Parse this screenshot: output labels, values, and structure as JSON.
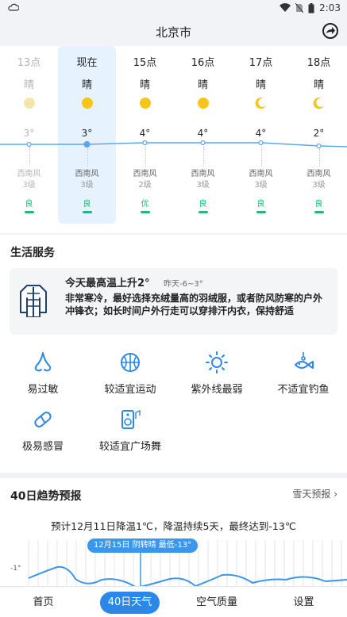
{
  "status": {
    "time": "2:03"
  },
  "header": {
    "city": "北京市",
    "share_icon": "share-icon"
  },
  "hourly": [
    {
      "label": "13点",
      "cond": "晴",
      "icon": "sun",
      "temp": "3°",
      "wind": "西南风",
      "level": "3级",
      "aqi": "良",
      "aqi_color": "#27b57c",
      "state": "past",
      "temp_value": 3
    },
    {
      "label": "现在",
      "cond": "晴",
      "icon": "sun",
      "temp": "3°",
      "wind": "西南风",
      "level": "3级",
      "aqi": "良",
      "aqi_color": "#27b57c",
      "state": "current",
      "temp_value": 3
    },
    {
      "label": "15点",
      "cond": "晴",
      "icon": "sun",
      "temp": "4°",
      "wind": "西南风",
      "level": "2级",
      "aqi": "优",
      "aqi_color": "#27b57c",
      "state": "future",
      "temp_value": 4
    },
    {
      "label": "16点",
      "cond": "晴",
      "icon": "sun",
      "temp": "4°",
      "wind": "西南风",
      "level": "3级",
      "aqi": "良",
      "aqi_color": "#27b57c",
      "state": "future",
      "temp_value": 4
    },
    {
      "label": "17点",
      "cond": "晴",
      "icon": "moon",
      "temp": "4°",
      "wind": "西南风",
      "level": "3级",
      "aqi": "良",
      "aqi_color": "#27b57c",
      "state": "future",
      "temp_value": 4
    },
    {
      "label": "18点",
      "cond": "晴",
      "icon": "moon",
      "temp": "2°",
      "wind": "西南风",
      "level": "3级",
      "aqi": "良",
      "aqi_color": "#27b57c",
      "state": "future",
      "temp_value": 2
    }
  ],
  "life": {
    "title": "生活服务",
    "tip": {
      "headline": "今天最高温上升2°",
      "sub": "昨天-6~3°",
      "body": "非常寒冷，最好选择充绒量高的羽绒服，或者防风防寒的户外冲锋衣；如长时间户外行走可以穿排汗内衣，保持舒适"
    },
    "services": [
      {
        "label": "易过敏",
        "icon": "nose-icon"
      },
      {
        "label": "较适宜运动",
        "icon": "basketball-icon"
      },
      {
        "label": "紫外线最弱",
        "icon": "sun-icon"
      },
      {
        "label": "不适宜钓鱼",
        "icon": "fish-icon"
      },
      {
        "label": "极易感冒",
        "icon": "pill-icon"
      },
      {
        "label": "较适宜广场舞",
        "icon": "speaker-icon"
      }
    ]
  },
  "trend": {
    "title": "40日趋势预报",
    "link": "雪天预报",
    "summary": "预计12月11日降温1℃，降温持续5天，最终达到-13℃",
    "bubble": "12月15日 阴转晴 最低-13°",
    "axis_label": "-1°"
  },
  "tabs": [
    {
      "label": "首页",
      "active": false
    },
    {
      "label": "40日天气",
      "active": true
    },
    {
      "label": "空气质量",
      "active": false
    },
    {
      "label": "设置",
      "active": false
    }
  ],
  "colors": {
    "accent": "#2c88e6",
    "line": "#5aa8ee",
    "sun": "#f5c518",
    "good": "#27b57c"
  }
}
